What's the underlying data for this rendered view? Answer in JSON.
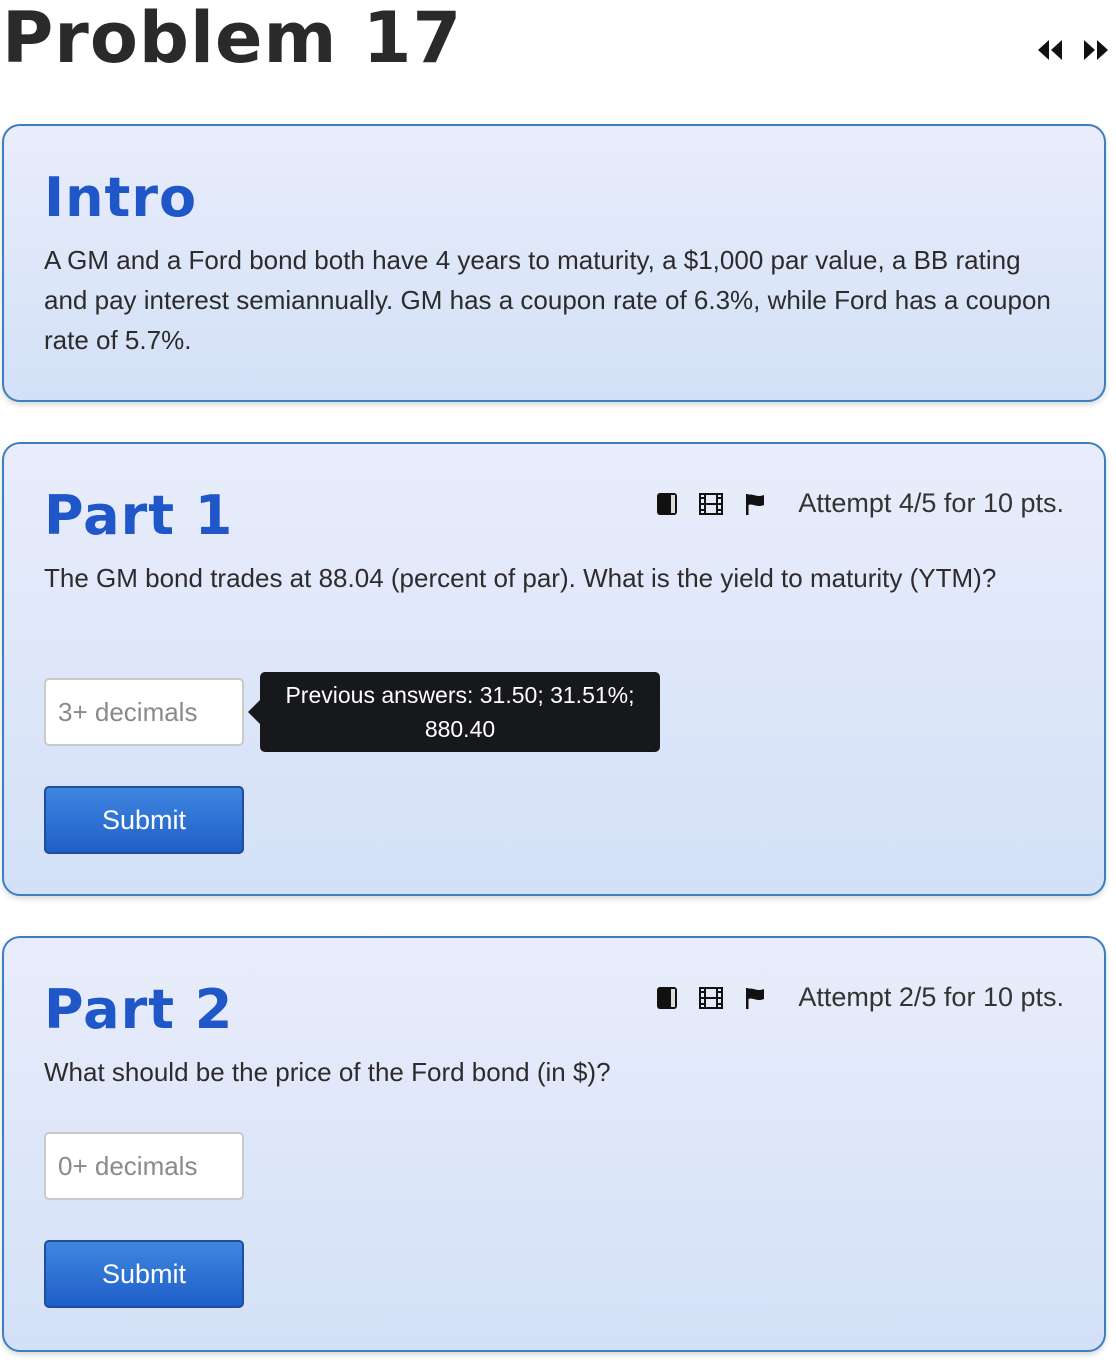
{
  "page": {
    "title": "Problem 17"
  },
  "nav": {
    "prev_icon": "rewind-icon",
    "next_icon": "fast-forward-icon"
  },
  "intro": {
    "heading": "Intro",
    "text": "A GM and a Ford bond both have 4 years to maturity, a $1,000 par value, a BB rating and pay interest semiannually. GM has a coupon rate of 6.3%, while Ford has a coupon rate of 5.7%."
  },
  "parts": [
    {
      "heading": "Part 1",
      "question": "The GM bond trades at 88.04 (percent of par). What is the yield to maturity (YTM)?",
      "attempt": "Attempt 4/5 for 10 pts.",
      "input_placeholder": "3+ decimals",
      "input_value": "",
      "tooltip": {
        "line1": "Previous answers: 31.50; 31.51%;",
        "line2": "880.40"
      },
      "submit_label": "Submit"
    },
    {
      "heading": "Part 2",
      "question": "What should be the price of the Ford bond (in $)?",
      "attempt": "Attempt 2/5 for 10 pts.",
      "input_placeholder": "0+ decimals",
      "input_value": "",
      "submit_label": "Submit"
    }
  ],
  "toolbar_icons": [
    "book-icon",
    "film-icon",
    "flag-icon"
  ],
  "colors": {
    "heading_blue": "#1f56c8",
    "card_border": "#3c7fc0",
    "button_blue": "#2a6fd6",
    "tooltip_bg": "#16181b"
  }
}
